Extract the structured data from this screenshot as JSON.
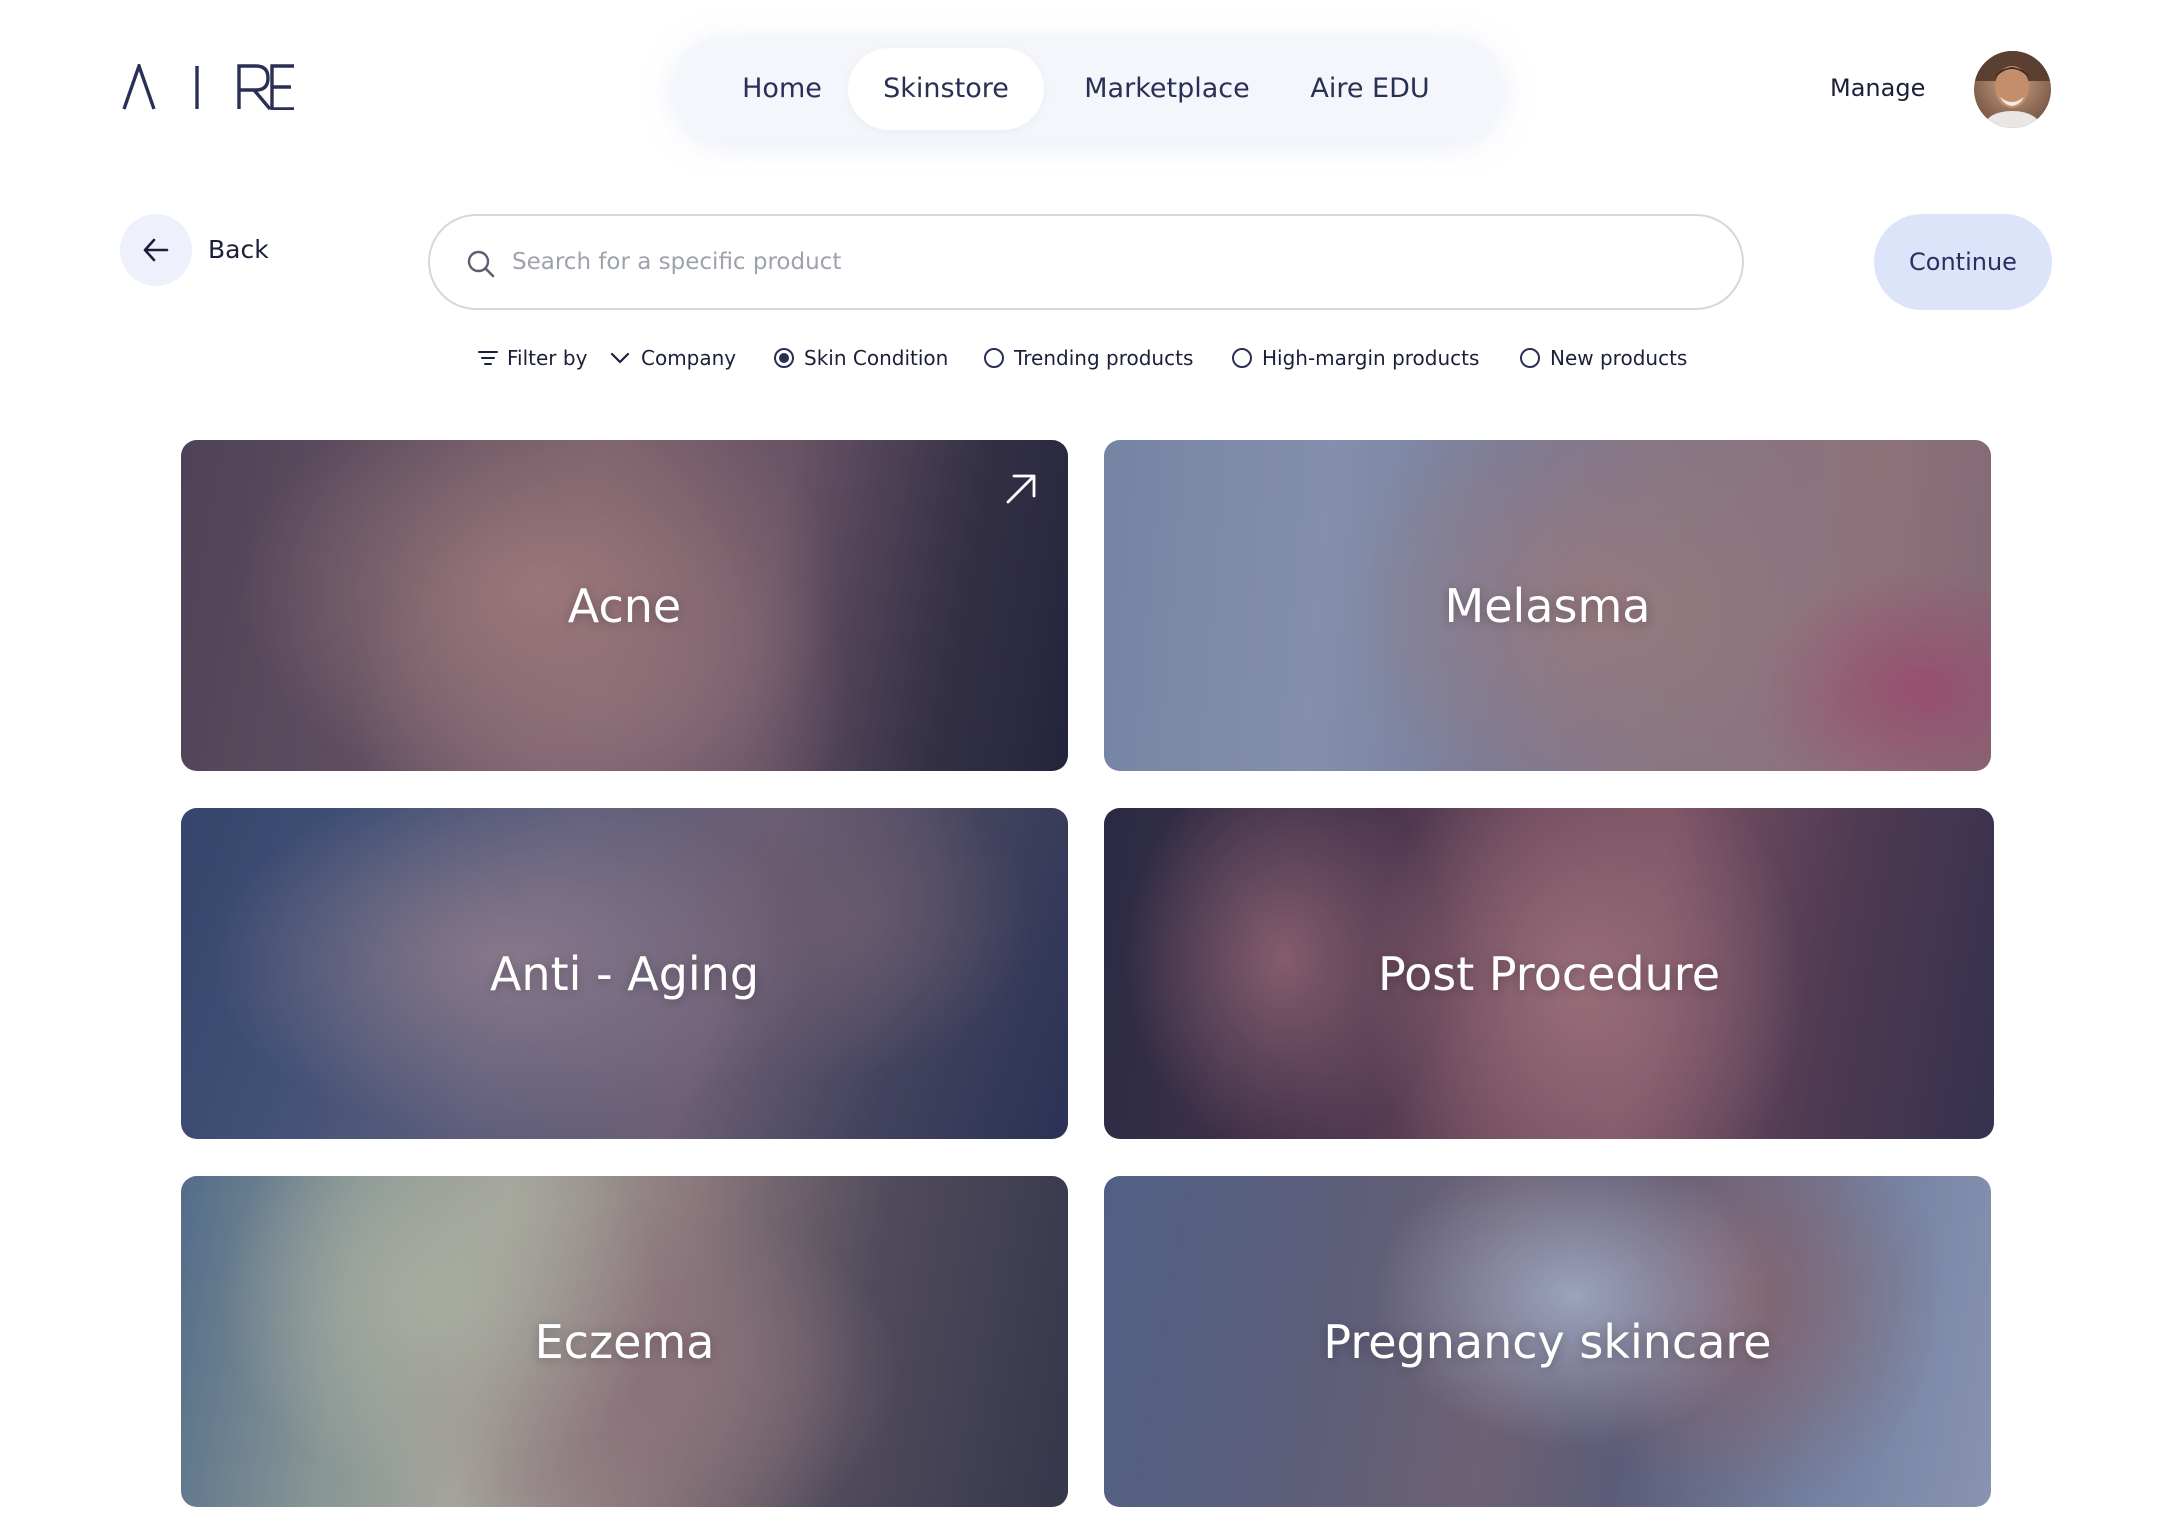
{
  "brand": {
    "logo_text": "AIRE"
  },
  "nav": {
    "items": [
      {
        "label": "Home",
        "active": false
      },
      {
        "label": "Skinstore",
        "active": true
      },
      {
        "label": "Marketplace",
        "active": false
      },
      {
        "label": "Aire EDU",
        "active": false
      }
    ]
  },
  "header": {
    "manage_label": "Manage",
    "avatar_icon": "user-avatar-photo"
  },
  "toolbar": {
    "back_label": "Back",
    "search_placeholder": "Search for a specific product",
    "search_value": "",
    "continue_label": "Continue"
  },
  "filters": {
    "filter_by_label": "Filter by",
    "company_label": "Company",
    "options": [
      {
        "label": "Skin Condition",
        "checked": true
      },
      {
        "label": "Trending products",
        "checked": false
      },
      {
        "label": "High-margin products",
        "checked": false
      },
      {
        "label": "New products",
        "checked": false
      }
    ]
  },
  "cards": [
    {
      "title": "Acne"
    },
    {
      "title": "Melasma"
    },
    {
      "title": "Anti - Aging"
    },
    {
      "title": "Post Procedure"
    },
    {
      "title": "Eczema"
    },
    {
      "title": "Pregnancy skincare"
    }
  ],
  "colors": {
    "accent_button": "#dce4fa",
    "text_primary": "#1c1f3a",
    "nav_bg": "#f4f6fb"
  }
}
